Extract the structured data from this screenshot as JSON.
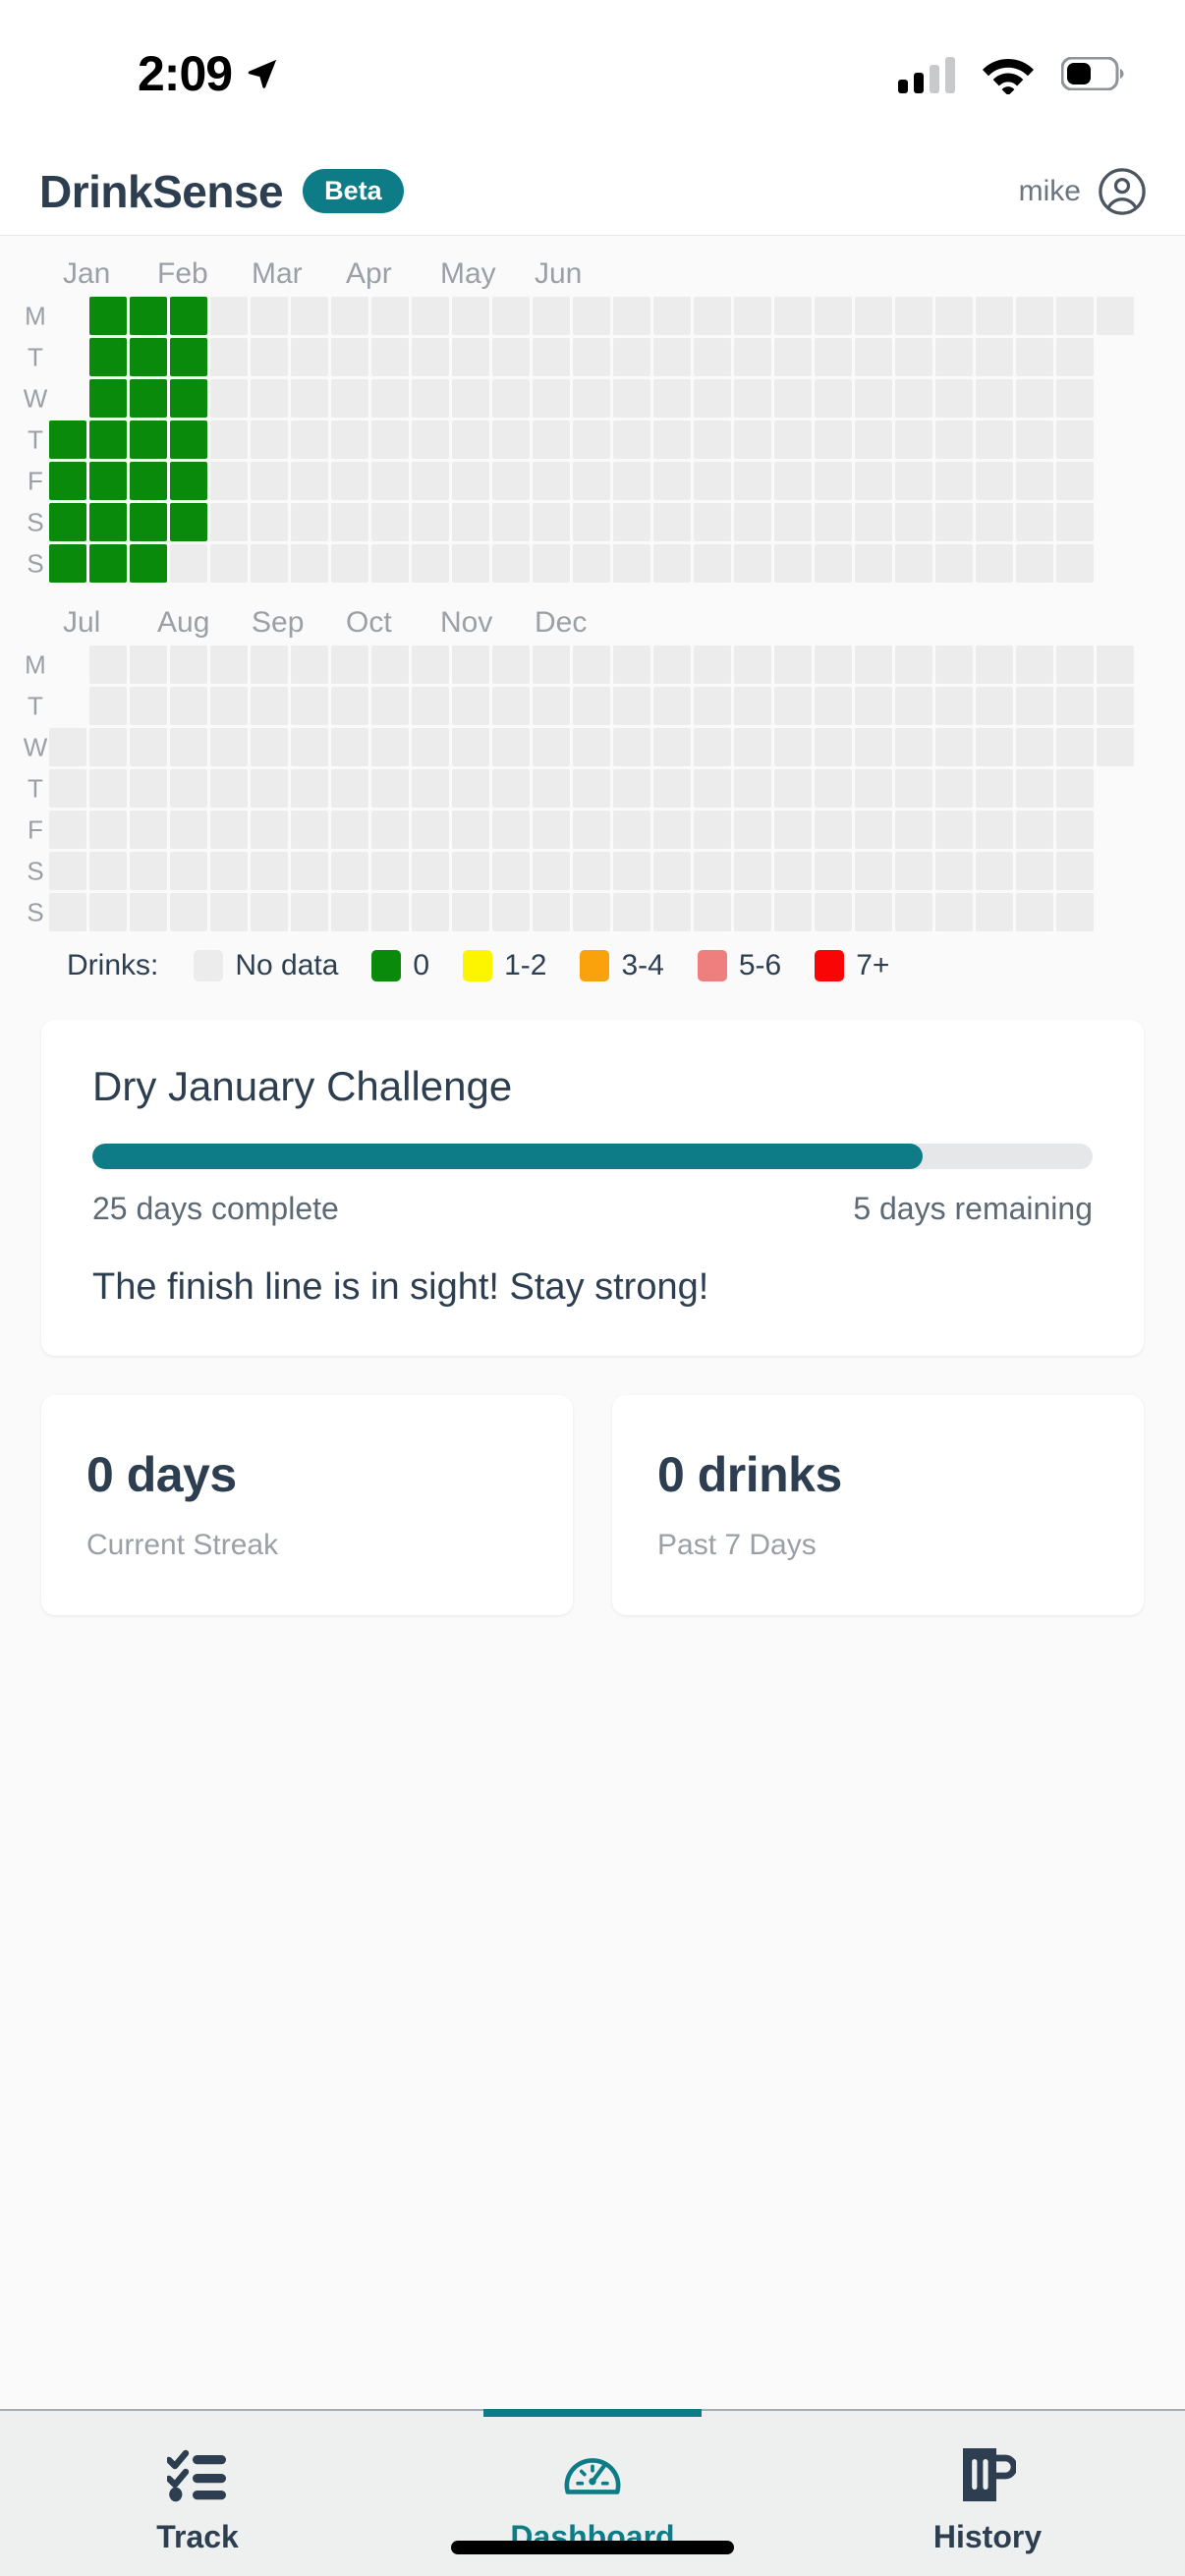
{
  "status_bar": {
    "time": "2:09",
    "location_icon": "location-arrow-icon",
    "cellular_icon": "cellular-signal-icon",
    "cellular_bars_filled": 2,
    "cellular_bars_total": 4,
    "wifi_icon": "wifi-icon",
    "battery_icon": "battery-icon",
    "battery_level_percent": 50
  },
  "header": {
    "app_name": "DrinkSense",
    "badge": "Beta",
    "badge_color": "#0e7c86",
    "user_name": "mike",
    "avatar_icon": "user-circle-icon"
  },
  "heatmap": {
    "day_labels": [
      "M",
      "T",
      "W",
      "T",
      "F",
      "S",
      "S"
    ],
    "rows_first_half": [
      {
        "day": "M",
        "offset": 1,
        "count": 26
      },
      {
        "day": "T",
        "offset": 1,
        "count": 25
      },
      {
        "day": "W",
        "offset": 1,
        "count": 25
      },
      {
        "day": "T",
        "offset": 0,
        "count": 26
      },
      {
        "day": "F",
        "offset": 0,
        "count": 26
      },
      {
        "day": "S",
        "offset": 0,
        "count": 26
      },
      {
        "day": "S",
        "offset": 0,
        "count": 26
      }
    ],
    "rows_second_half": [
      {
        "day": "M",
        "offset": 1,
        "count": 26
      },
      {
        "day": "T",
        "offset": 1,
        "count": 26
      },
      {
        "day": "W",
        "offset": 0,
        "count": 27
      },
      {
        "day": "T",
        "offset": 0,
        "count": 26
      },
      {
        "day": "F",
        "offset": 0,
        "count": 26
      },
      {
        "day": "S",
        "offset": 0,
        "count": 26
      },
      {
        "day": "S",
        "offset": 0,
        "count": 26
      }
    ],
    "months_first_half": [
      "Jan",
      "Feb",
      "Mar",
      "Apr",
      "May",
      "Jun"
    ],
    "months_second_half": [
      "Jul",
      "Aug",
      "Sep",
      "Oct",
      "Nov",
      "Dec"
    ],
    "month_positions_first": [
      14,
      110,
      206,
      302,
      398,
      494
    ],
    "month_positions_second": [
      14,
      110,
      206,
      302,
      398,
      494
    ],
    "filled_weeks": [
      {
        "week_index": 0,
        "days": [
          3,
          4,
          5,
          6
        ]
      },
      {
        "week_index": 1,
        "days": [
          0,
          1,
          2,
          3,
          4,
          5,
          6
        ]
      },
      {
        "week_index": 2,
        "days": [
          0,
          1,
          2,
          3,
          4,
          5,
          6
        ]
      },
      {
        "week_index": 3,
        "days": [
          0,
          1,
          2,
          3,
          4,
          5
        ]
      }
    ],
    "filled_total_days": 25,
    "filled_color": "#0a8a0a",
    "empty_color": "#ececec"
  },
  "legend": {
    "title": "Drinks:",
    "items": [
      {
        "label": "No data",
        "color": "#ececec"
      },
      {
        "label": "0",
        "color": "#0a8a0a"
      },
      {
        "label": "1-2",
        "color": "#fdf500"
      },
      {
        "label": "3-4",
        "color": "#f9a20b"
      },
      {
        "label": "5-6",
        "color": "#ef7f7f"
      },
      {
        "label": "7+",
        "color": "#fa0505"
      }
    ]
  },
  "challenge": {
    "title": "Dry January Challenge",
    "progress_percent": 83,
    "progress_color": "#0e7c86",
    "days_complete": "25 days complete",
    "days_remaining": "5 days remaining",
    "message": "The finish line is in sight! Stay strong!"
  },
  "stats": [
    {
      "value": "0 days",
      "label": "Current Streak"
    },
    {
      "value": "0 drinks",
      "label": "Past 7 Days"
    }
  ],
  "bottom_nav": {
    "active_color": "#0e7c86",
    "items": [
      {
        "label": "Track",
        "icon": "checklist-icon",
        "active": false
      },
      {
        "label": "Dashboard",
        "icon": "gauge-icon",
        "active": true
      },
      {
        "label": "History",
        "icon": "beer-mug-icon",
        "active": false
      }
    ]
  }
}
